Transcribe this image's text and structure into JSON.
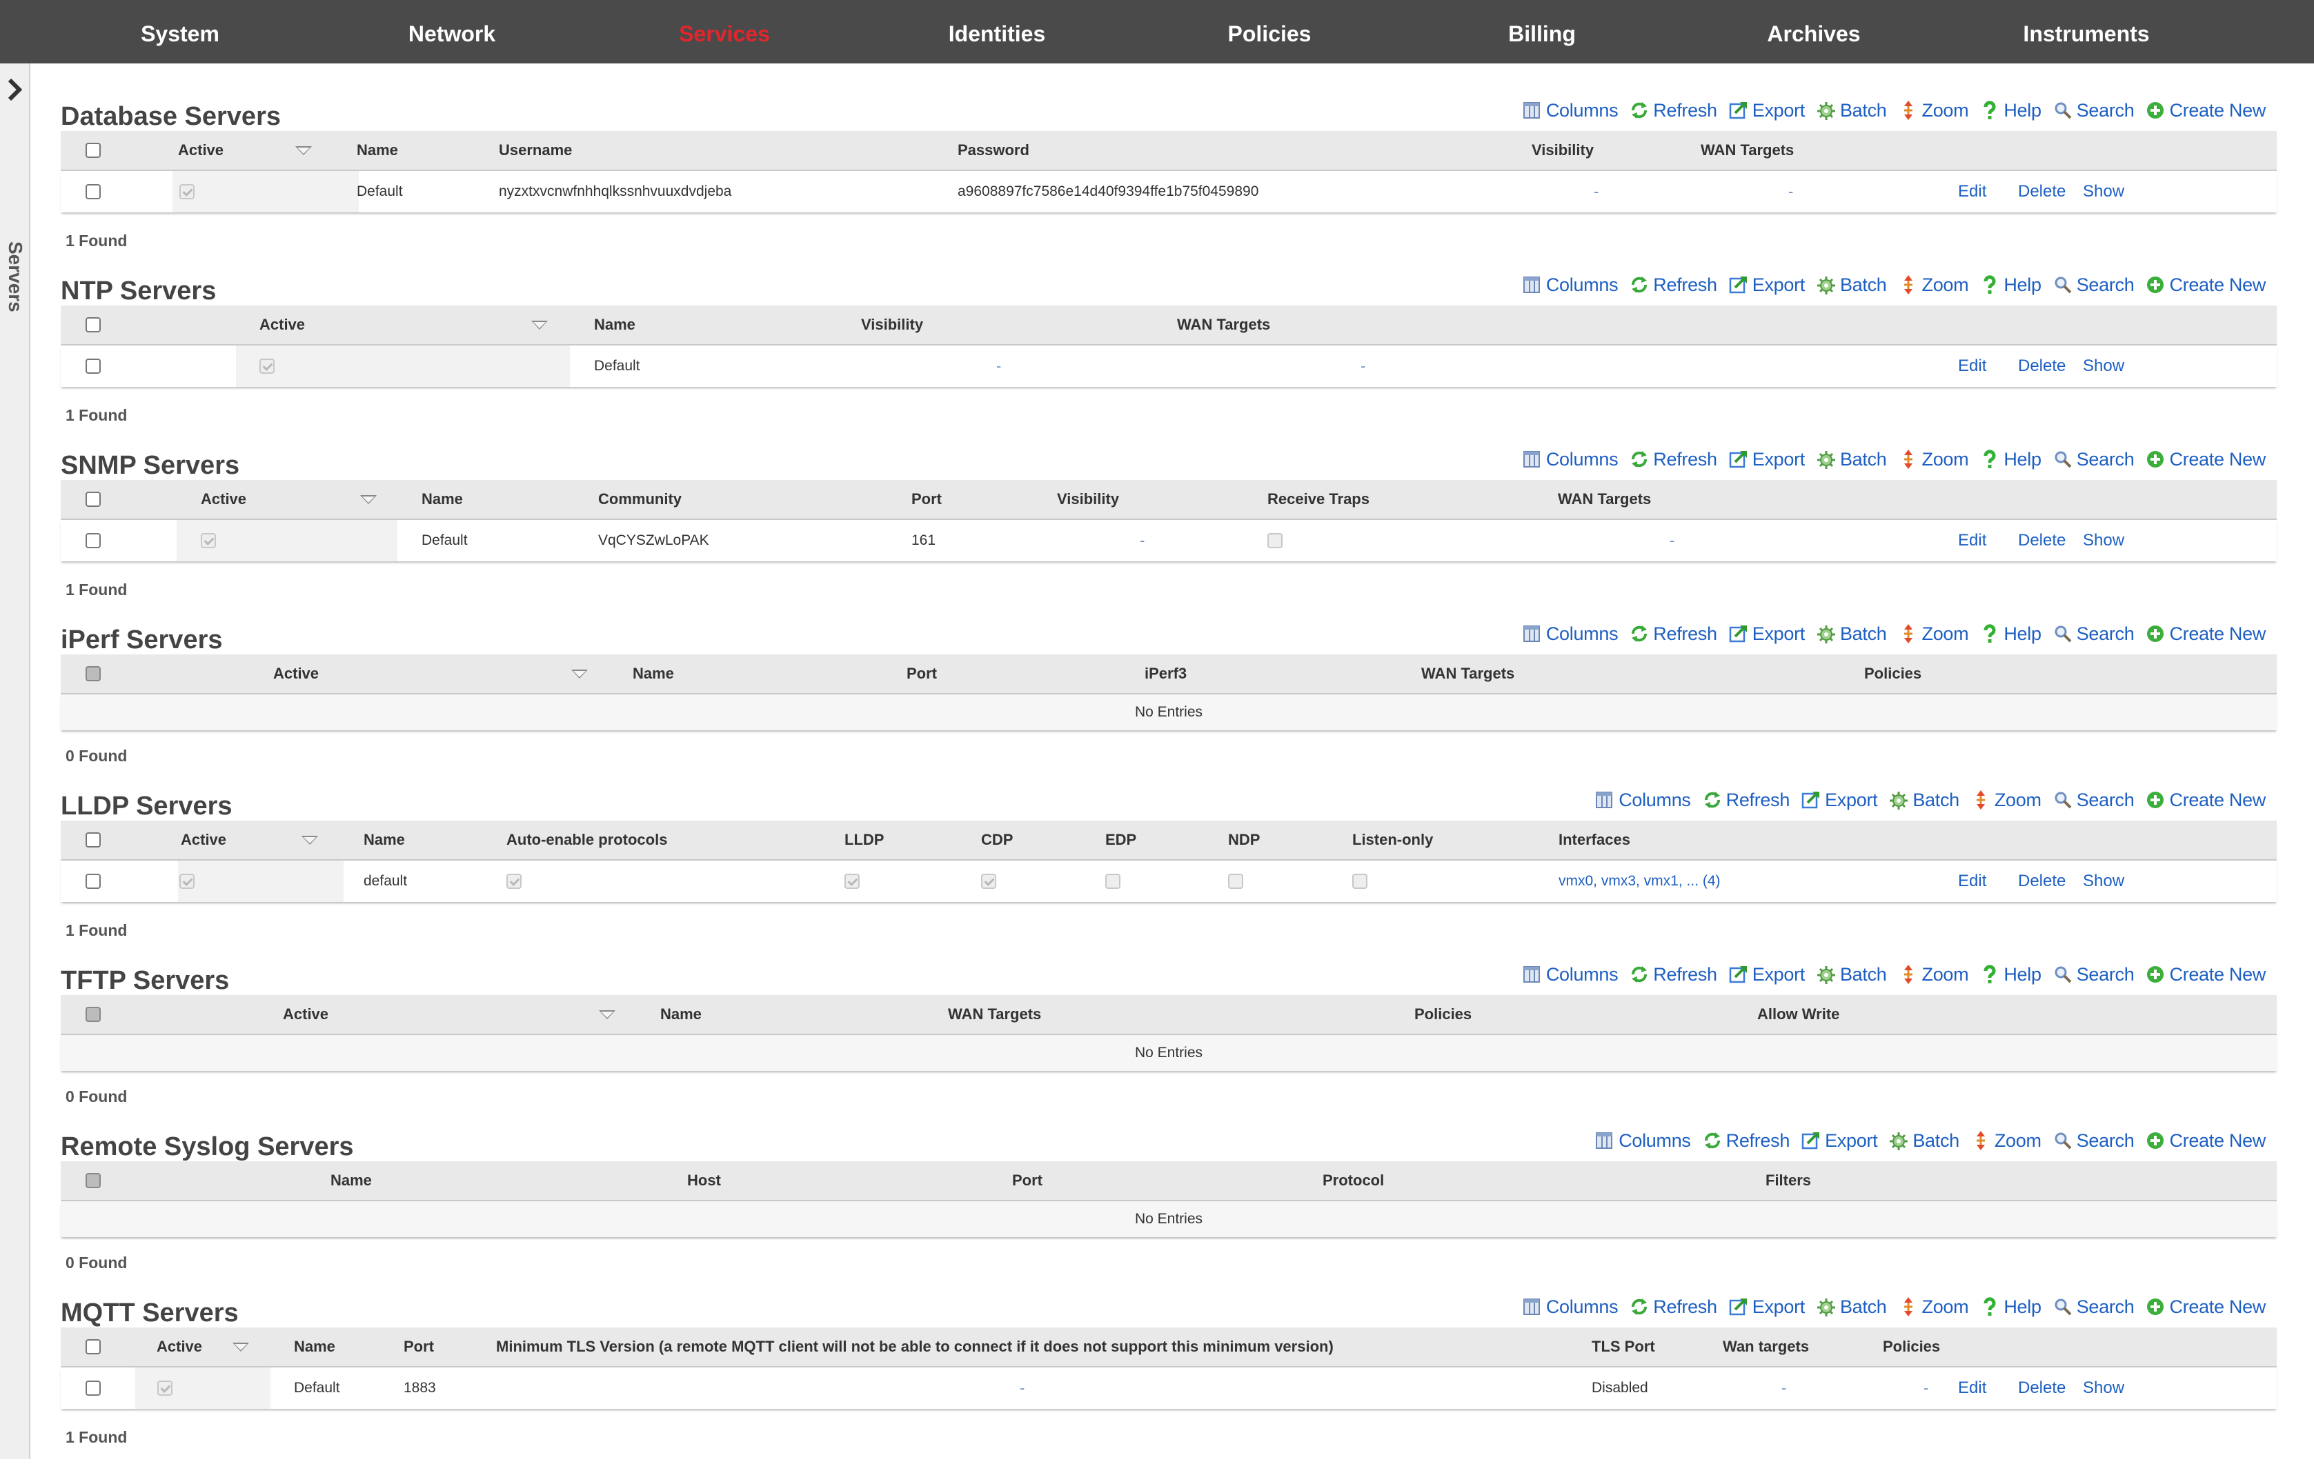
{
  "nav": [
    "System",
    "Network",
    "Services",
    "Identities",
    "Policies",
    "Billing",
    "Archives",
    "Instruments"
  ],
  "nav_active": "Services",
  "sidebar_label": "Servers",
  "toolbar_full": [
    "Columns",
    "Refresh",
    "Export",
    "Batch",
    "Zoom",
    "Help",
    "Search",
    "Create New"
  ],
  "toolbar_nohelp": [
    "Columns",
    "Refresh",
    "Export",
    "Batch",
    "Zoom",
    "Search",
    "Create New"
  ],
  "row_actions": [
    "Edit",
    "Delete",
    "Show"
  ],
  "no_entries": "No Entries",
  "sections": {
    "database": {
      "title": "Database Servers",
      "headers": [
        "Active",
        "Name",
        "Username",
        "Password",
        "Visibility",
        "WAN Targets"
      ],
      "row": {
        "name": "Default",
        "username": "nyzxtxvcnwfnhhqlkssnhvuuxdvdjeba",
        "password": "a9608897fc7586e14d40f9394ffe1b75f0459890",
        "visibility": "-",
        "wan": "-"
      },
      "found": "1 Found"
    },
    "ntp": {
      "title": "NTP Servers",
      "headers": [
        "Active",
        "Name",
        "Visibility",
        "WAN Targets"
      ],
      "row": {
        "name": "Default",
        "visibility": "-",
        "wan": "-"
      },
      "found": "1 Found"
    },
    "snmp": {
      "title": "SNMP Servers",
      "headers": [
        "Active",
        "Name",
        "Community",
        "Port",
        "Visibility",
        "Receive Traps",
        "WAN Targets"
      ],
      "row": {
        "name": "Default",
        "community": "VqCYSZwLoPAK",
        "port": "161",
        "visibility": "-",
        "wan": "-"
      },
      "found": "1 Found"
    },
    "iperf": {
      "title": "iPerf Servers",
      "headers": [
        "Active",
        "Name",
        "Port",
        "iPerf3",
        "WAN Targets",
        "Policies"
      ],
      "found": "0 Found"
    },
    "lldp": {
      "title": "LLDP Servers",
      "headers": [
        "Active",
        "Name",
        "Auto-enable protocols",
        "LLDP",
        "CDP",
        "EDP",
        "NDP",
        "Listen-only",
        "Interfaces"
      ],
      "row": {
        "name": "default",
        "interfaces": "vmx0, vmx3, vmx1, ... (4)"
      },
      "found": "1 Found"
    },
    "tftp": {
      "title": "TFTP Servers",
      "headers": [
        "Active",
        "Name",
        "WAN Targets",
        "Policies",
        "Allow Write"
      ],
      "found": "0 Found"
    },
    "syslog": {
      "title": "Remote Syslog Servers",
      "headers": [
        "Name",
        "Host",
        "Port",
        "Protocol",
        "Filters"
      ],
      "found": "0 Found"
    },
    "mqtt": {
      "title": "MQTT Servers",
      "headers": [
        "Active",
        "Name",
        "Port",
        "Minimum TLS Version (a remote MQTT client will not be able to connect if it does not support this minimum version)",
        "TLS Port",
        "Wan targets",
        "Policies"
      ],
      "row": {
        "name": "Default",
        "port": "1883",
        "tls_version": "-",
        "tls_port": "Disabled",
        "wan": "-",
        "policies": "-"
      },
      "found": "1 Found"
    }
  },
  "icons": {
    "columns": "columns-icon",
    "refresh": "refresh-icon",
    "export": "export-icon",
    "batch": "batch-icon",
    "zoom": "zoom-icon",
    "help": "help-icon",
    "search": "search-icon",
    "create": "create-new-icon"
  },
  "colors": {
    "nav_bg": "#4a4a4a",
    "nav_active": "#e3262b",
    "link": "#1d5fc2"
  }
}
